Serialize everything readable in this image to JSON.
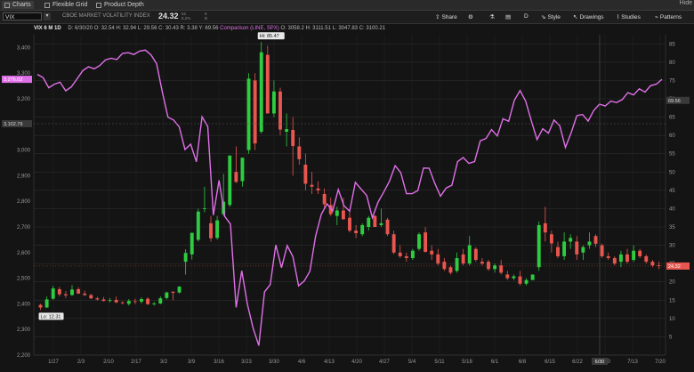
{
  "tabs": {
    "charts": "Charts",
    "flexible_grid": "Flexible Grid",
    "product_depth": "Product Depth",
    "close": "Hide"
  },
  "toolbar": {
    "symbol": "VIX",
    "description": "CBOE MARKET VOLATILITY INDEX",
    "last": "24.32",
    "change_top": "52",
    "change_bottom": "5.2%",
    "bid_top": "8",
    "bid_bottom": "B",
    "share": "Share",
    "style": "Style",
    "drawings": "Drawings",
    "studies": "Studies",
    "patterns": "Patterns",
    "d_label": "D"
  },
  "header": {
    "chart_title": "VIX 6 M 1D",
    "date": "D: 6/30/20",
    "open": "O: 32.54",
    "high": "H: 32.94",
    "low": "L: 29.56",
    "close": "C: 30.43",
    "range": "R: 3.38",
    "extra": "Y: 69.56",
    "comparison": "Comparison (LINE, SPX)",
    "cmp_open": "O: 3058.2",
    "cmp_high": "H: 3111.51",
    "cmp_low": "L: 3047.83",
    "cmp_close": "C: 3100.21"
  },
  "colors": {
    "up": "#2ecc40",
    "down": "#e8564f",
    "comparison": "#e070e8",
    "grid": "#2c2c2c",
    "background": "#141414"
  },
  "chart_data": {
    "type": "candlestick",
    "title": "VIX 6 M 1D",
    "x_ticks": [
      "1/27",
      "2/3",
      "2/10",
      "2/17",
      "3/2",
      "3/9",
      "3/16",
      "3/23",
      "3/30",
      "4/6",
      "4/13",
      "4/20",
      "4/27",
      "5/4",
      "5/11",
      "5/18",
      "6/1",
      "6/8",
      "6/15",
      "6/22",
      "6/30",
      "7/13",
      "7/20"
    ],
    "left_axis": {
      "ticks": [
        "3,400",
        "3,300",
        "3,200",
        "3,100",
        "3,000",
        "2,900",
        "2,800",
        "2,700",
        "2,600",
        "2,500",
        "2,400",
        "2,300",
        "2,200"
      ],
      "ylim": [
        2200,
        3450
      ]
    },
    "right_axis": {
      "ticks": [
        "85",
        "80",
        "75",
        "70",
        "65",
        "60",
        "55",
        "50",
        "45",
        "40",
        "35",
        "30",
        "25",
        "20",
        "15",
        "10",
        "5"
      ],
      "ylim": [
        0,
        87.5
      ]
    },
    "annotations": {
      "high": "Hi: 85.47",
      "low": "Lo: 12.31",
      "cmp_price": "3,276.02",
      "left_cursor": "3,102.79",
      "right_cursor": "69.56",
      "last_price": "24.32",
      "cursor_date": "6/30"
    },
    "candles": [
      {
        "o": 13.7,
        "h": 14.0,
        "l": 12.3,
        "c": 13.0
      },
      {
        "o": 13.0,
        "h": 16.0,
        "l": 12.9,
        "c": 15.2
      },
      {
        "o": 15.4,
        "h": 18.9,
        "l": 15.1,
        "c": 18.2
      },
      {
        "o": 18.0,
        "h": 18.6,
        "l": 16.0,
        "c": 16.6
      },
      {
        "o": 16.6,
        "h": 17.5,
        "l": 15.6,
        "c": 16.3
      },
      {
        "o": 16.4,
        "h": 19.1,
        "l": 16.2,
        "c": 17.9
      },
      {
        "o": 18.0,
        "h": 18.5,
        "l": 16.7,
        "c": 16.8
      },
      {
        "o": 16.8,
        "h": 17.6,
        "l": 16.1,
        "c": 16.4
      },
      {
        "o": 16.4,
        "h": 16.7,
        "l": 15.3,
        "c": 15.5
      },
      {
        "o": 15.5,
        "h": 15.9,
        "l": 14.9,
        "c": 15.2
      },
      {
        "o": 15.2,
        "h": 15.9,
        "l": 14.6,
        "c": 14.8
      },
      {
        "o": 14.9,
        "h": 15.6,
        "l": 14.4,
        "c": 15.0
      },
      {
        "o": 15.1,
        "h": 16.0,
        "l": 14.2,
        "c": 14.4
      },
      {
        "o": 14.4,
        "h": 14.7,
        "l": 13.8,
        "c": 14.2
      },
      {
        "o": 14.0,
        "h": 15.3,
        "l": 13.5,
        "c": 14.8
      },
      {
        "o": 14.7,
        "h": 15.4,
        "l": 13.9,
        "c": 14.6
      },
      {
        "o": 14.6,
        "h": 15.8,
        "l": 14.1,
        "c": 15.3
      },
      {
        "o": 15.4,
        "h": 15.8,
        "l": 13.7,
        "c": 13.9
      },
      {
        "o": 14.1,
        "h": 14.5,
        "l": 13.5,
        "c": 14.1
      },
      {
        "o": 14.1,
        "h": 16.0,
        "l": 13.9,
        "c": 15.5
      },
      {
        "o": 15.6,
        "h": 17.3,
        "l": 15.2,
        "c": 17.1
      },
      {
        "o": 17.3,
        "h": 17.4,
        "l": 15.0,
        "c": 17.0
      },
      {
        "o": 17.1,
        "h": 18.8,
        "l": 16.8,
        "c": 18.7
      },
      {
        "o": 25.5,
        "h": 28.9,
        "l": 22.0,
        "c": 27.9
      },
      {
        "o": 27.5,
        "h": 33.4,
        "l": 26.1,
        "c": 33.4
      },
      {
        "o": 31.5,
        "h": 40.0,
        "l": 31.0,
        "c": 39.2
      },
      {
        "o": 40.0,
        "h": 46.0,
        "l": 39.0,
        "c": 40.1
      },
      {
        "o": 36.0,
        "h": 38.0,
        "l": 31.0,
        "c": 31.9
      },
      {
        "o": 32.0,
        "h": 38.0,
        "l": 31.5,
        "c": 36.8
      },
      {
        "o": 38.5,
        "h": 49.5,
        "l": 38.0,
        "c": 41.9
      },
      {
        "o": 41.0,
        "h": 54.0,
        "l": 40.5,
        "c": 54.5
      },
      {
        "o": 50.0,
        "h": 57.0,
        "l": 47.0,
        "c": 47.3
      },
      {
        "o": 47.5,
        "h": 54.0,
        "l": 46.0,
        "c": 53.9
      },
      {
        "o": 56.0,
        "h": 77.0,
        "l": 55.0,
        "c": 75.5
      },
      {
        "o": 75.0,
        "h": 77.0,
        "l": 56.0,
        "c": 57.8
      },
      {
        "o": 61.0,
        "h": 85.5,
        "l": 60.5,
        "c": 82.7
      },
      {
        "o": 82.0,
        "h": 84.5,
        "l": 66.0,
        "c": 66.0
      },
      {
        "o": 66.0,
        "h": 75.0,
        "l": 65.0,
        "c": 72.0
      },
      {
        "o": 72.0,
        "h": 73.0,
        "l": 60.0,
        "c": 61.6
      },
      {
        "o": 61.0,
        "h": 66.0,
        "l": 57.0,
        "c": 61.7
      },
      {
        "o": 61.5,
        "h": 65.0,
        "l": 49.0,
        "c": 57.1
      },
      {
        "o": 57.0,
        "h": 59.5,
        "l": 52.0,
        "c": 53.5
      },
      {
        "o": 52.0,
        "h": 55.0,
        "l": 45.0,
        "c": 46.8
      },
      {
        "o": 46.5,
        "h": 50.0,
        "l": 44.0,
        "c": 46.0
      },
      {
        "o": 45.5,
        "h": 47.5,
        "l": 44.0,
        "c": 45.0
      },
      {
        "o": 44.0,
        "h": 45.5,
        "l": 40.0,
        "c": 41.2
      },
      {
        "o": 41.0,
        "h": 43.0,
        "l": 38.0,
        "c": 38.5
      },
      {
        "o": 38.0,
        "h": 40.5,
        "l": 35.5,
        "c": 39.5
      },
      {
        "o": 39.5,
        "h": 43.0,
        "l": 37.0,
        "c": 37.1
      },
      {
        "o": 37.5,
        "h": 39.0,
        "l": 33.5,
        "c": 34.0
      },
      {
        "o": 34.0,
        "h": 35.5,
        "l": 32.0,
        "c": 33.3
      },
      {
        "o": 33.0,
        "h": 36.0,
        "l": 32.5,
        "c": 35.5
      },
      {
        "o": 35.0,
        "h": 38.0,
        "l": 34.0,
        "c": 37.5
      },
      {
        "o": 38.0,
        "h": 38.2,
        "l": 35.0,
        "c": 35.0
      },
      {
        "o": 35.5,
        "h": 40.0,
        "l": 35.0,
        "c": 36.0
      },
      {
        "o": 37.0,
        "h": 37.5,
        "l": 32.5,
        "c": 33.0
      },
      {
        "o": 33.0,
        "h": 34.0,
        "l": 27.5,
        "c": 28.0
      },
      {
        "o": 28.0,
        "h": 30.0,
        "l": 26.5,
        "c": 27.0
      },
      {
        "o": 27.0,
        "h": 28.0,
        "l": 25.5,
        "c": 26.5
      },
      {
        "o": 26.5,
        "h": 29.0,
        "l": 26.0,
        "c": 28.5
      },
      {
        "o": 29.0,
        "h": 33.5,
        "l": 28.5,
        "c": 33.0
      },
      {
        "o": 33.5,
        "h": 35.0,
        "l": 28.0,
        "c": 28.2
      },
      {
        "o": 28.5,
        "h": 30.0,
        "l": 26.0,
        "c": 27.5
      },
      {
        "o": 27.5,
        "h": 29.0,
        "l": 24.5,
        "c": 25.0
      },
      {
        "o": 25.5,
        "h": 26.5,
        "l": 23.0,
        "c": 23.5
      },
      {
        "o": 24.0,
        "h": 24.5,
        "l": 22.0,
        "c": 22.5
      },
      {
        "o": 23.0,
        "h": 28.0,
        "l": 22.5,
        "c": 26.5
      },
      {
        "o": 27.5,
        "h": 29.0,
        "l": 24.5,
        "c": 25.0
      },
      {
        "o": 25.0,
        "h": 32.5,
        "l": 24.5,
        "c": 30.0
      },
      {
        "o": 29.0,
        "h": 29.5,
        "l": 25.5,
        "c": 26.0
      },
      {
        "o": 25.5,
        "h": 26.5,
        "l": 24.5,
        "c": 25.0
      },
      {
        "o": 25.5,
        "h": 26.0,
        "l": 23.0,
        "c": 23.5
      },
      {
        "o": 23.5,
        "h": 25.0,
        "l": 22.5,
        "c": 24.5
      },
      {
        "o": 24.5,
        "h": 26.0,
        "l": 22.0,
        "c": 22.5
      },
      {
        "o": 22.0,
        "h": 23.0,
        "l": 20.5,
        "c": 21.0
      },
      {
        "o": 21.0,
        "h": 22.0,
        "l": 20.5,
        "c": 21.5
      },
      {
        "o": 21.5,
        "h": 23.0,
        "l": 19.0,
        "c": 19.5
      },
      {
        "o": 19.5,
        "h": 21.0,
        "l": 19.0,
        "c": 20.5
      },
      {
        "o": 20.5,
        "h": 22.0,
        "l": 21.0,
        "c": 22.0
      },
      {
        "o": 24.0,
        "h": 36.5,
        "l": 23.0,
        "c": 35.5
      },
      {
        "o": 36.0,
        "h": 40.5,
        "l": 31.0,
        "c": 33.5
      },
      {
        "o": 33.0,
        "h": 34.0,
        "l": 28.0,
        "c": 30.5
      },
      {
        "o": 29.5,
        "h": 31.0,
        "l": 26.5,
        "c": 27.0
      },
      {
        "o": 27.0,
        "h": 33.5,
        "l": 26.0,
        "c": 31.0
      },
      {
        "o": 31.0,
        "h": 33.0,
        "l": 29.0,
        "c": 32.0
      },
      {
        "o": 31.0,
        "h": 32.5,
        "l": 26.0,
        "c": 27.5
      },
      {
        "o": 28.0,
        "h": 30.0,
        "l": 26.0,
        "c": 29.5
      },
      {
        "o": 30.0,
        "h": 33.5,
        "l": 29.0,
        "c": 31.0
      },
      {
        "o": 32.5,
        "h": 33.0,
        "l": 29.5,
        "c": 30.4
      },
      {
        "o": 30.0,
        "h": 30.5,
        "l": 26.5,
        "c": 27.0
      },
      {
        "o": 27.0,
        "h": 28.0,
        "l": 26.0,
        "c": 26.5
      },
      {
        "o": 26.5,
        "h": 27.0,
        "l": 24.5,
        "c": 25.0
      },
      {
        "o": 25.5,
        "h": 28.5,
        "l": 24.0,
        "c": 27.5
      },
      {
        "o": 27.5,
        "h": 29.0,
        "l": 25.0,
        "c": 25.5
      },
      {
        "o": 26.0,
        "h": 30.0,
        "l": 25.5,
        "c": 28.5
      },
      {
        "o": 28.5,
        "h": 29.0,
        "l": 26.5,
        "c": 27.0
      },
      {
        "o": 27.0,
        "h": 27.5,
        "l": 25.0,
        "c": 25.5
      },
      {
        "o": 25.5,
        "h": 26.0,
        "l": 24.0,
        "c": 24.5
      },
      {
        "o": 24.5,
        "h": 25.5,
        "l": 23.5,
        "c": 24.3
      }
    ],
    "comparison_series": {
      "name": "SPX",
      "values": [
        3295,
        3283,
        3243,
        3257,
        3265,
        3231,
        3247,
        3278,
        3310,
        3325,
        3317,
        3330,
        3352,
        3358,
        3353,
        3377,
        3380,
        3373,
        3386,
        3390,
        3372,
        3337,
        3227,
        3128,
        3117,
        3090,
        3002,
        3023,
        2954,
        3130,
        3092,
        2746,
        2882,
        2741,
        2711,
        2386,
        2529,
        2398,
        2305,
        2237,
        2447,
        2475,
        2630,
        2541,
        2627,
        2584,
        2470,
        2489,
        2527,
        2664,
        2749,
        2790,
        2762,
        2846,
        2783,
        2761,
        2874,
        2848,
        2823,
        2736,
        2797,
        2836,
        2878,
        2939,
        2912,
        2830,
        2830,
        2842,
        2930,
        2929,
        2870,
        2820,
        2852,
        2863,
        2955,
        2971,
        2948,
        2955,
        3036,
        3045,
        3080,
        3055,
        3122,
        3112,
        3194,
        3232,
        3191,
        3114,
        3041,
        3083,
        3066,
        3117,
        3095,
        3010,
        3067,
        3134,
        3139,
        3113,
        3155,
        3179,
        3172,
        3191,
        3185,
        3197,
        3224,
        3215,
        3239,
        3226,
        3251,
        3257,
        3276
      ]
    }
  }
}
